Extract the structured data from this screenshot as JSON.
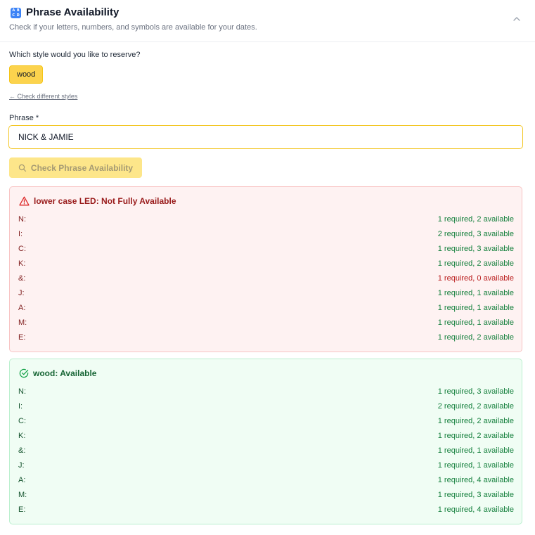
{
  "header": {
    "title": "Phrase Availability",
    "subtitle": "Check if your letters, numbers, and symbols are available for your dates.",
    "icon_glyphs": [
      "A",
      "B",
      "C",
      "D"
    ]
  },
  "style_section": {
    "question": "Which style would you like to reserve?",
    "selected_style": "wood",
    "back_link": "← Check different styles"
  },
  "phrase": {
    "label": "Phrase *",
    "value": "NICK & JAMIE"
  },
  "check_button": {
    "label": "Check Phrase Availability"
  },
  "results": [
    {
      "title": "lower case LED: Not Fully Available",
      "status": "unavailable",
      "rows": [
        {
          "char": "N:",
          "text": "1 required, 2 available",
          "ok": true
        },
        {
          "char": "I:",
          "text": "2 required, 3 available",
          "ok": true
        },
        {
          "char": "C:",
          "text": "1 required, 3 available",
          "ok": true
        },
        {
          "char": "K:",
          "text": "1 required, 2 available",
          "ok": true
        },
        {
          "char": "&:",
          "text": "1 required, 0 available",
          "ok": false
        },
        {
          "char": "J:",
          "text": "1 required, 1 available",
          "ok": true
        },
        {
          "char": "A:",
          "text": "1 required, 1 available",
          "ok": true
        },
        {
          "char": "M:",
          "text": "1 required, 1 available",
          "ok": true
        },
        {
          "char": "E:",
          "text": "1 required, 2 available",
          "ok": true
        }
      ]
    },
    {
      "title": "wood: Available",
      "status": "available",
      "rows": [
        {
          "char": "N:",
          "text": "1 required, 3 available",
          "ok": true
        },
        {
          "char": "I:",
          "text": "2 required, 2 available",
          "ok": true
        },
        {
          "char": "C:",
          "text": "1 required, 2 available",
          "ok": true
        },
        {
          "char": "K:",
          "text": "1 required, 2 available",
          "ok": true
        },
        {
          "char": "&:",
          "text": "1 required, 1 available",
          "ok": true
        },
        {
          "char": "J:",
          "text": "1 required, 1 available",
          "ok": true
        },
        {
          "char": "A:",
          "text": "1 required, 4 available",
          "ok": true
        },
        {
          "char": "M:",
          "text": "1 required, 3 available",
          "ok": true
        },
        {
          "char": "E:",
          "text": "1 required, 4 available",
          "ok": true
        }
      ]
    }
  ],
  "colors": {
    "accent": "#fcd34d",
    "ok_text": "#15803d",
    "error_text": "#b91c1c"
  }
}
